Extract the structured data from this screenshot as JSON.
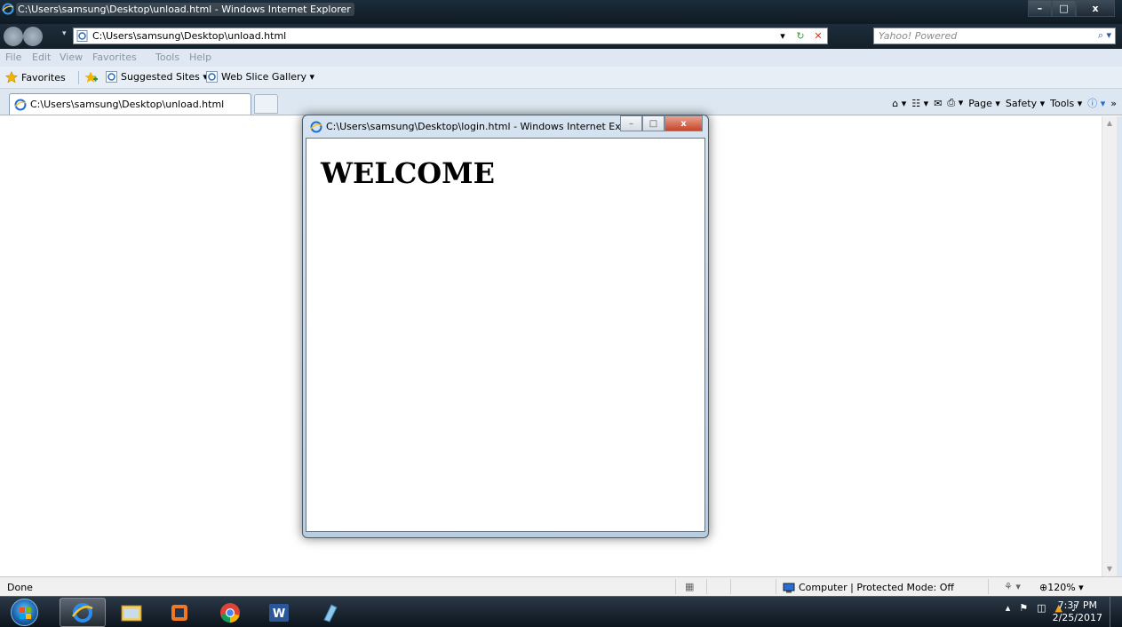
{
  "window": {
    "title": "C:\\Users\\samsung\\Desktop\\unload.html - Windows Internet Explorer",
    "controls": {
      "minimize": "–",
      "maximize": "□",
      "close": "x"
    }
  },
  "address_bar": {
    "url": "C:\\Users\\samsung\\Desktop\\unload.html",
    "refresh_icon": "↻",
    "stop_icon": "✕",
    "dropdown": "▾"
  },
  "search": {
    "provider": "Yahoo! Powered",
    "go_icon": "⌕ ▾"
  },
  "menu": [
    "File",
    "Edit",
    "View",
    "Favorites",
    "Tools",
    "Help"
  ],
  "favorites_bar": {
    "favorites_label": "Favorites",
    "items": [
      "Suggested Sites ▾",
      "Web Slice Gallery ▾"
    ]
  },
  "tab": {
    "label": "C:\\Users\\samsung\\Desktop\\unload.html"
  },
  "command_bar": {
    "home": "⌂ ▾",
    "feeds": "☷ ▾",
    "mail": "✉",
    "print": "⎙ ▾",
    "page": "Page ▾",
    "safety": "Safety ▾",
    "tools": "Tools ▾",
    "help": "ⓘ ▾",
    "more": "»"
  },
  "status_bar": {
    "status": "Done",
    "zone": "Computer | Protected Mode: Off",
    "zoom": "⊕120%  ▾",
    "scroll_up": "▲",
    "scroll_down": "▼"
  },
  "popup": {
    "title": "C:\\Users\\samsung\\Desktop\\login.html - Windows Internet Explorer",
    "heading": "WELCOME"
  },
  "taskbar": {
    "clock_time": "7:37 PM",
    "clock_date": "2/25/2017",
    "pinned": [
      "internet-explorer",
      "file-explorer",
      "media-player",
      "chrome",
      "word",
      "notes"
    ]
  },
  "colors": {
    "ie_blue": "#1e6fd0",
    "star": "#f2b400",
    "word_blue": "#2b579a"
  }
}
